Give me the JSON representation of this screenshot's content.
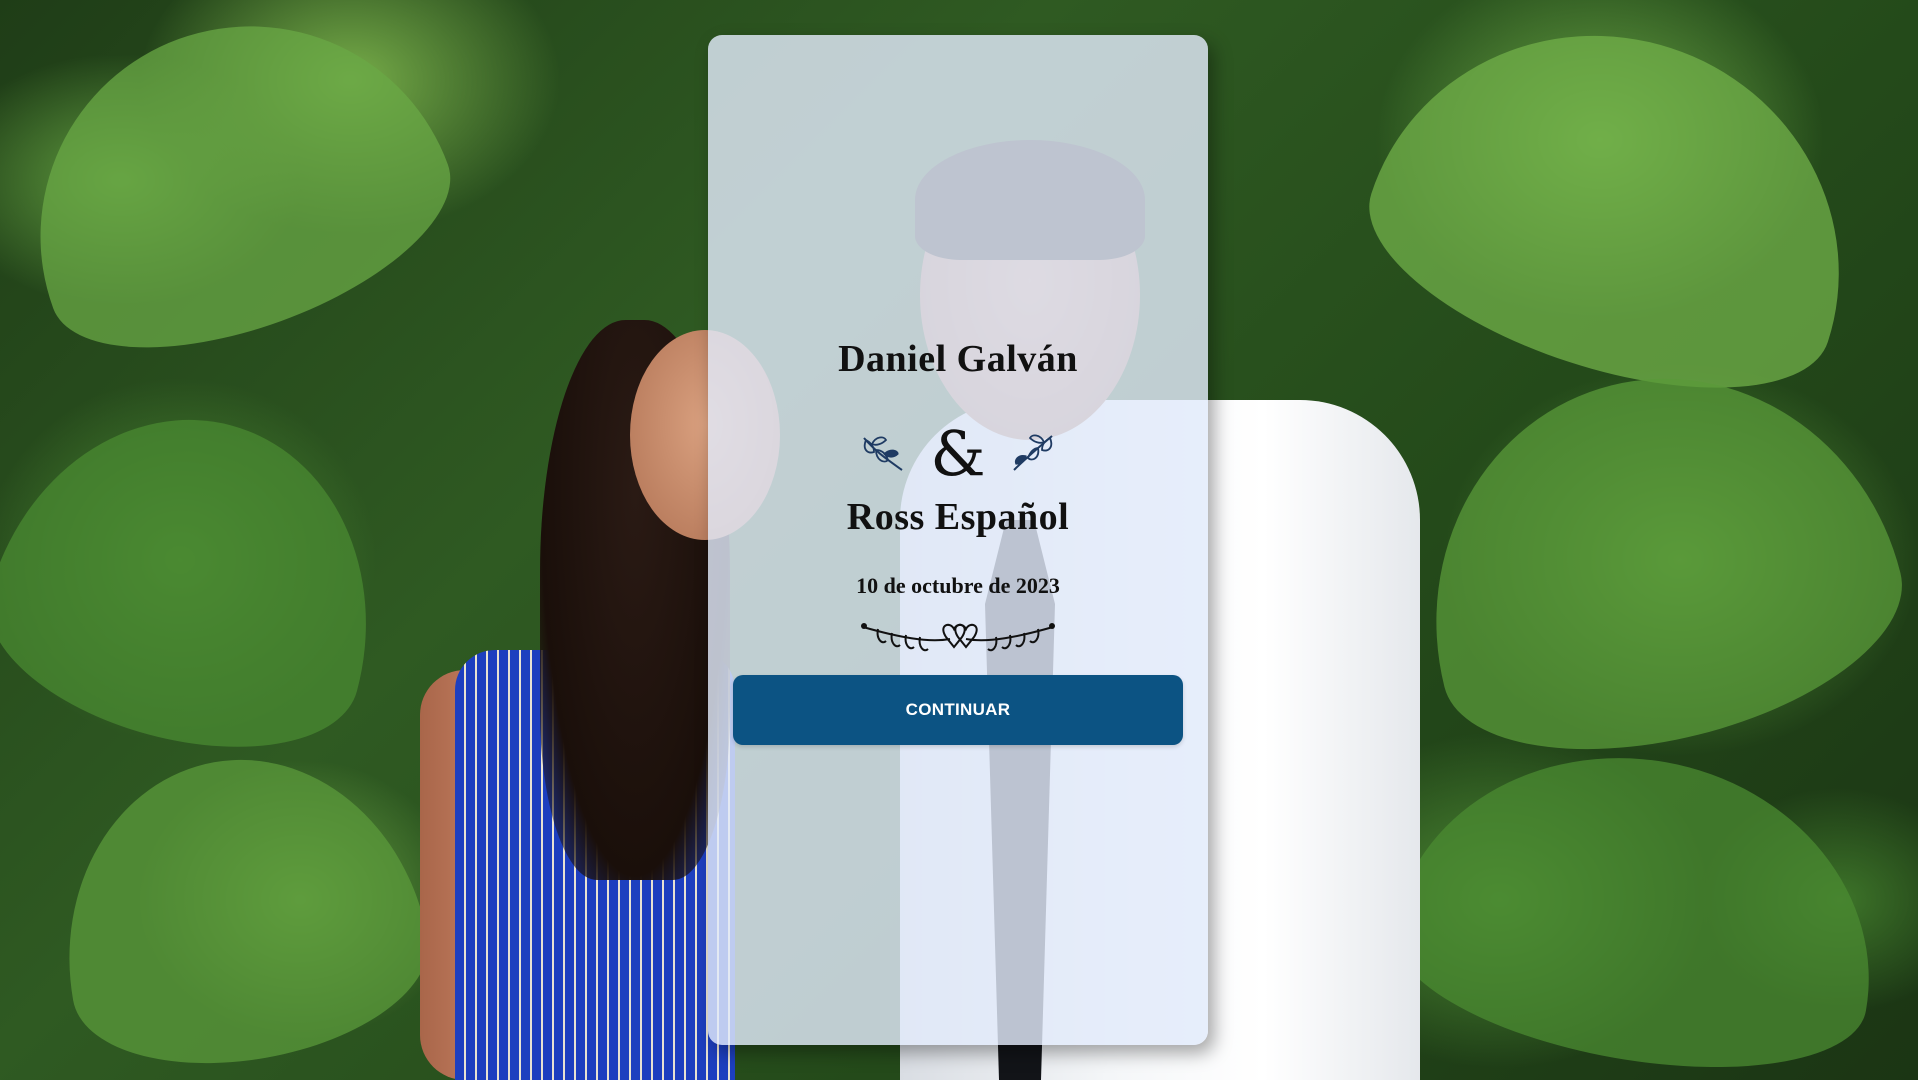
{
  "invitation": {
    "groom_name": "Daniel Galván",
    "ampersand": "&",
    "bride_name": "Ross Español",
    "date": "10 de octubre de 2023",
    "continue_label": "CONTINUAR"
  },
  "colors": {
    "card_background": "#e2eafa",
    "button_background": "#0c5383",
    "button_text": "#ffffff",
    "laurel_accent": "#1f3b63",
    "text": "#111111"
  },
  "icons": {
    "left_ornament": "laurel-branch-icon",
    "right_ornament": "laurel-branch-icon",
    "divider": "hearts-divider-icon"
  }
}
